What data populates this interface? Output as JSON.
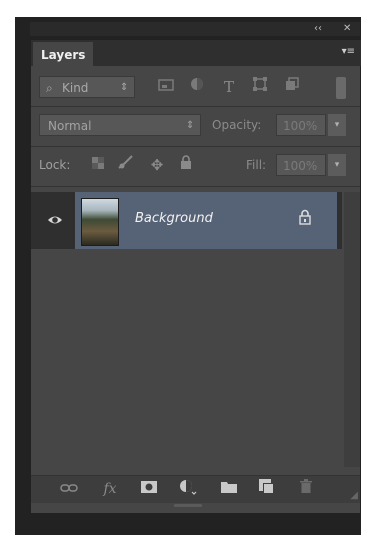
{
  "window": {
    "collapse_glyph": "‹‹",
    "close_glyph": "✕"
  },
  "panel": {
    "tab_label": "Layers",
    "menu_glyph": "▾≡"
  },
  "filter": {
    "kind_label": "Kind",
    "icons": [
      "image-filter-icon",
      "adjustment-filter-icon",
      "type-filter-icon",
      "shape-filter-icon",
      "smart-object-filter-icon",
      "filter-toggle-icon"
    ]
  },
  "blend": {
    "mode": "Normal",
    "opacity_label": "Opacity:",
    "opacity_value": "100%"
  },
  "lock": {
    "label": "Lock:",
    "fill_label": "Fill:",
    "fill_value": "100%",
    "icons": [
      "lock-transparent-icon",
      "lock-image-icon",
      "lock-position-icon",
      "lock-all-icon"
    ]
  },
  "layers": [
    {
      "name": "Background",
      "visible": true,
      "locked": true,
      "selected": true
    }
  ],
  "footer": {
    "icons": [
      "link-layers-icon",
      "fx-icon",
      "add-mask-icon",
      "adjustment-layer-icon",
      "new-group-icon",
      "new-layer-icon",
      "delete-layer-icon"
    ],
    "fx_glyph": "fx"
  }
}
